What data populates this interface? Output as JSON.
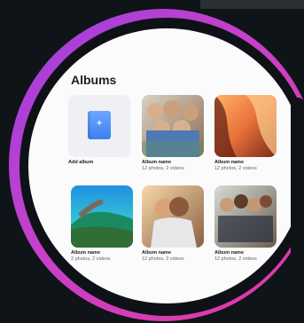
{
  "page": {
    "title": "Albums"
  },
  "albums": [
    {
      "label": "Add album",
      "meta": ""
    },
    {
      "label": "Album name",
      "meta": "12 photos, 2 videos"
    },
    {
      "label": "Album name",
      "meta": "12 photos, 2 videos"
    },
    {
      "label": "Album name",
      "meta": "2 photos, 2 videos"
    },
    {
      "label": "Album name",
      "meta": "12 photos, 2 videos"
    },
    {
      "label": "Album name",
      "meta": "12 photos, 2 videos"
    }
  ],
  "colors": {
    "ring_start": "#9b3fe0",
    "ring_end": "#e23aa0",
    "add_icon": "#3f7ef2"
  }
}
